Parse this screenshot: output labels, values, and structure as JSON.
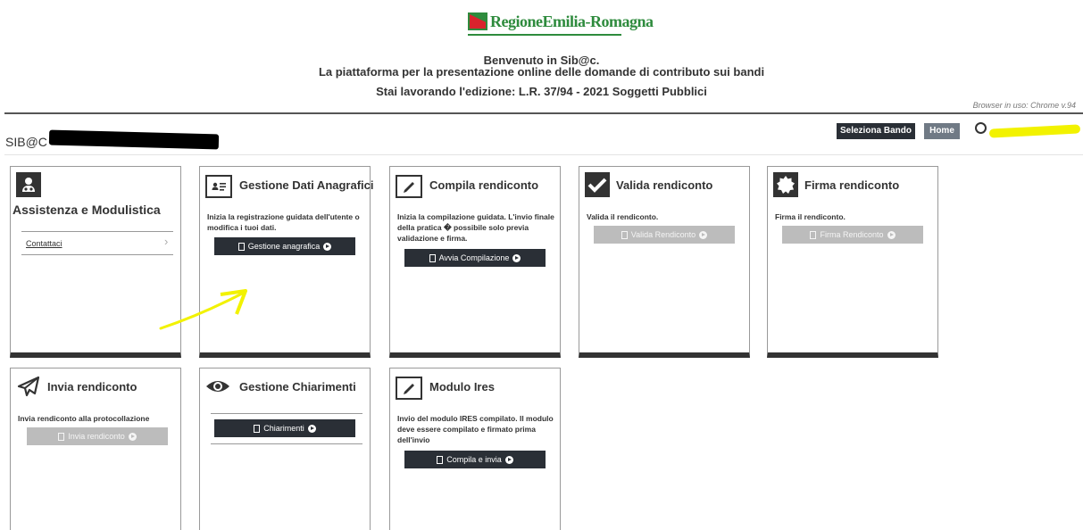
{
  "header": {
    "logo_text": "RegioneEmilia-Romagna",
    "welcome_line1": "Benvenuto in Sib@c.",
    "welcome_line2": "La piattaforma per la presentazione online delle domande di contributo sui bandi",
    "edition_line": "Stai lavorando l'edizione: L.R. 37/94 - 2021 Soggetti Pubblici",
    "browser_info": "Browser in uso: Chrome v.94"
  },
  "navbar": {
    "brand": "SIB@C",
    "seleziona_bando": "Seleziona Bando",
    "home": "Home"
  },
  "cards": {
    "assistenza": {
      "title": "Assistenza e Modulistica",
      "link": "Contattaci",
      "icon": "user-support-icon"
    },
    "gestione_dati": {
      "title": "Gestione Dati Anagrafici",
      "desc": "Inizia la registrazione guidata dell'utente o modifica i tuoi dati.",
      "button": "Gestione anagrafica",
      "icon": "id-card-icon"
    },
    "compila": {
      "title": "Compila rendiconto",
      "desc": "Inizia la compilazione guidata. L'invio finale della pratica � possibile solo previa validazione e firma.",
      "button": "Avvia Compilazione",
      "icon": "edit-icon"
    },
    "valida": {
      "title": "Valida rendiconto",
      "desc": "Valida il rendiconto.",
      "button": "Valida Rendiconto",
      "icon": "check-icon"
    },
    "firma": {
      "title": "Firma rendiconto",
      "desc": "Firma il rendiconto.",
      "button": "Firma Rendiconto",
      "icon": "seal-icon"
    },
    "invia": {
      "title": "Invia rendiconto",
      "desc": "Invia rendiconto alla protocollazione",
      "button": "Invia rendiconto",
      "icon": "paper-plane-icon"
    },
    "chiarimenti": {
      "title": "Gestione Chiarimenti",
      "button": "Chiarimenti",
      "icon": "eye-icon"
    },
    "ires": {
      "title": "Modulo Ires",
      "desc": "Invio del modulo IRES compilato. Il modulo deve essere compilato e firmato prima dell'invio",
      "button": "Compila e invia",
      "icon": "edit-icon"
    }
  },
  "colors": {
    "dark_button": "#2a2f36",
    "disabled_button": "#bcbcbc",
    "home_button": "#707a85",
    "logo_green": "#2e8b3d",
    "annotation_yellow": "#f2f200"
  }
}
